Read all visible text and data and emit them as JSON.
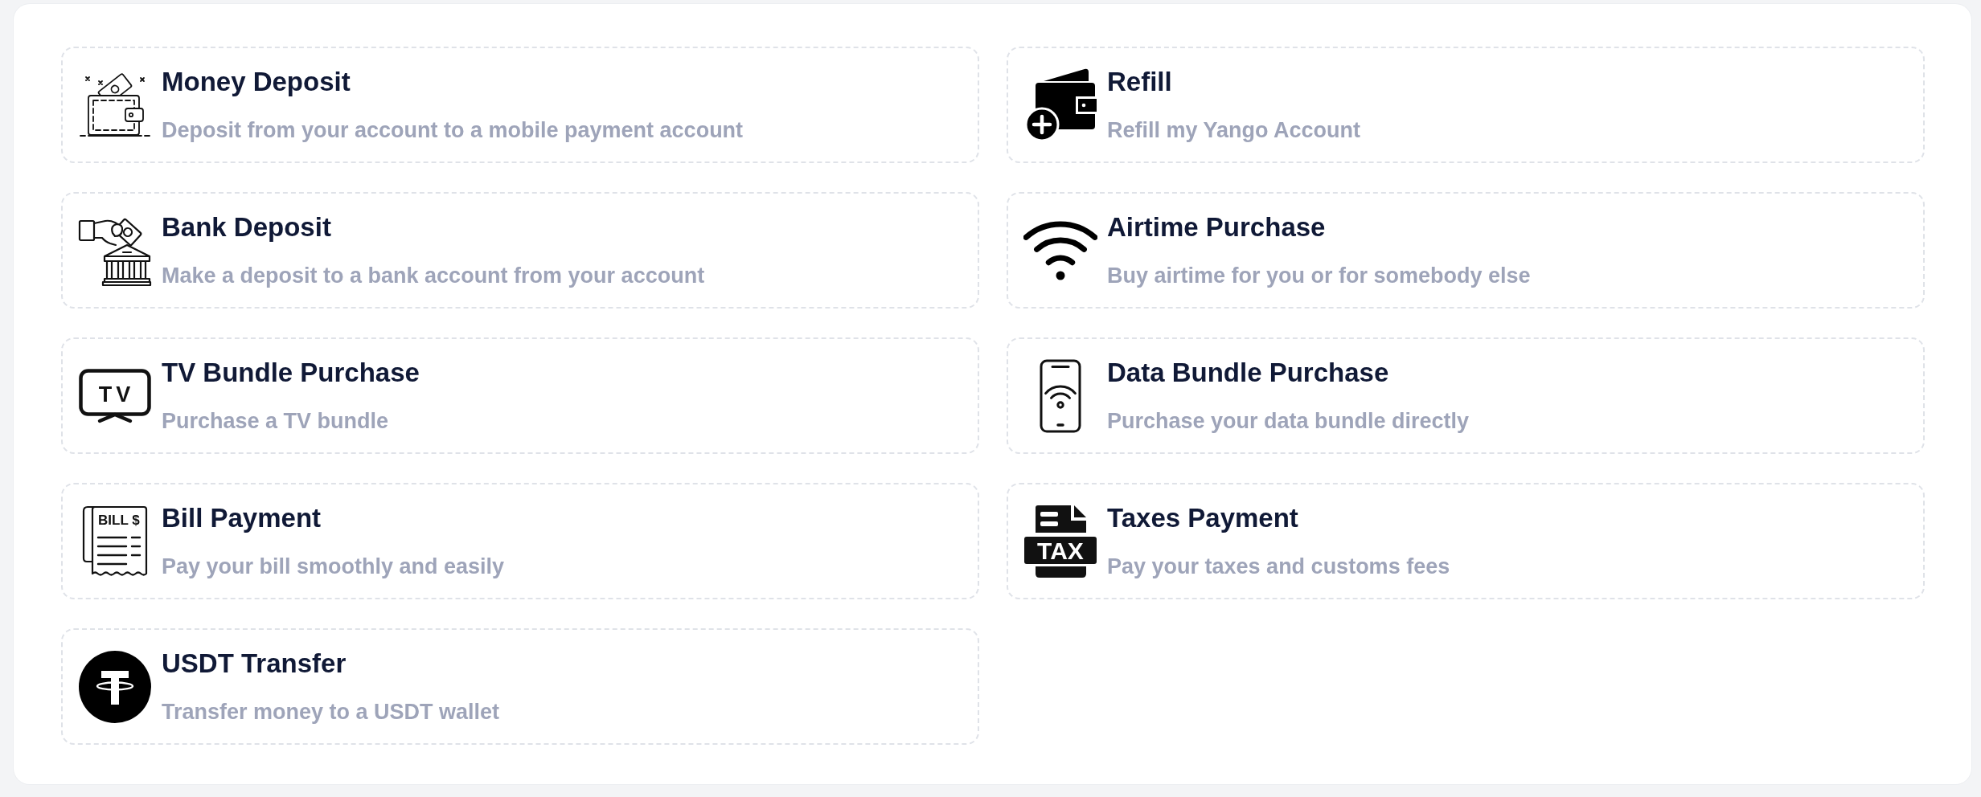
{
  "services": [
    {
      "kind": "wallet",
      "title": "Money Deposit",
      "description": "Deposit from your account to a mobile payment account"
    },
    {
      "kind": "refill",
      "title": "Refill",
      "description": "Refill my Yango Account"
    },
    {
      "kind": "bank",
      "title": "Bank Deposit",
      "description": "Make a deposit to a bank account from your account"
    },
    {
      "kind": "wifi",
      "title": "Airtime Purchase",
      "description": "Buy airtime for you or for somebody else"
    },
    {
      "kind": "tv",
      "icon_label": "TV",
      "title": "TV Bundle Purchase",
      "description": "Purchase a TV bundle"
    },
    {
      "kind": "phone",
      "title": "Data Bundle Purchase",
      "description": "Purchase your data bundle directly"
    },
    {
      "kind": "bill",
      "icon_label": "BILL $",
      "title": "Bill Payment",
      "description": "Pay your bill smoothly and easily"
    },
    {
      "kind": "tax",
      "icon_label": "TAX",
      "title": "Taxes Payment",
      "description": "Pay your taxes and customs fees"
    },
    {
      "kind": "coin",
      "title": "USDT Transfer",
      "description": "Transfer money to a USDT wallet"
    }
  ]
}
